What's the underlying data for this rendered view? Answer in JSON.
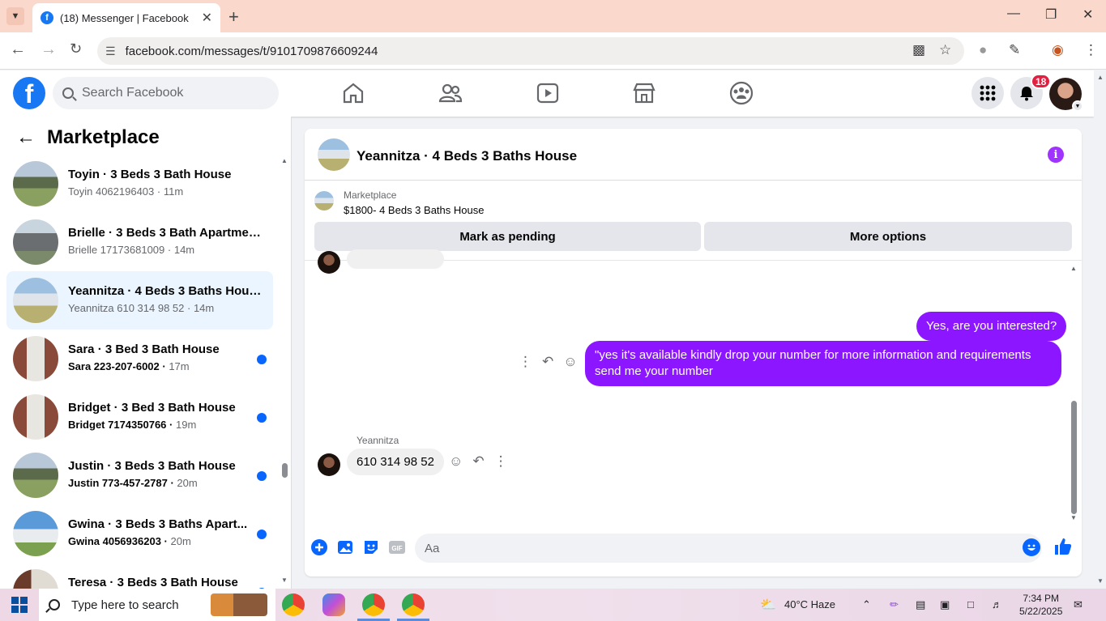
{
  "browser": {
    "tab_title": "(18) Messenger | Facebook",
    "url": "facebook.com/messages/t/9101709876609244"
  },
  "header": {
    "search_placeholder": "Search Facebook",
    "notification_count": "18",
    "brand_color": "#1877f2"
  },
  "sidebar": {
    "title": "Marketplace",
    "conversations": [
      {
        "name": "Toyin · 3 Beds 3 Bath House",
        "sub": "Toyin 4062196403",
        "time": "11m",
        "unread": false,
        "active": false
      },
      {
        "name": "Brielle · 3 Beds 3 Bath Apartmen...",
        "sub": "Brielle 17173681009",
        "time": "14m",
        "unread": false,
        "active": false
      },
      {
        "name": "Yeannitza · 4 Beds 3 Baths House",
        "sub": "Yeannitza 610 314 98 52",
        "time": "14m",
        "unread": false,
        "active": true
      },
      {
        "name": "Sara · 3 Bed 3 Bath House",
        "sub": "Sara 223-207-6002",
        "time": "17m",
        "unread": true,
        "active": false
      },
      {
        "name": "Bridget · 3 Bed 3 Bath House",
        "sub": "Bridget 7174350766",
        "time": "19m",
        "unread": true,
        "active": false
      },
      {
        "name": "Justin · 3 Beds 3 Bath House",
        "sub": "Justin 773-457-2787",
        "time": "20m",
        "unread": true,
        "active": false
      },
      {
        "name": "Gwina · 3 Beds 3 Baths Apart...",
        "sub": "Gwina 4056936203",
        "time": "20m",
        "unread": true,
        "active": false
      },
      {
        "name": "Teresa · 3 Beds 3 Bath House",
        "sub": "",
        "time": "",
        "unread": true,
        "active": false
      }
    ]
  },
  "chat": {
    "title": "Yeannitza · 4 Beds 3 Baths House",
    "marketplace_label": "Marketplace",
    "listing": "$1800- 4 Beds 3 Baths House",
    "mark_pending": "Mark as pending",
    "more_options": "More options",
    "messages": {
      "out1": "Yes, are you interested?",
      "out2": "\"yes it's available kindly drop your number for more information and requirements send me your number",
      "in_sender": "Yeannitza",
      "in1": "610 314 98 52"
    },
    "composer_placeholder": "Aa",
    "bubble_color": "#8b16ff"
  },
  "taskbar": {
    "search_text": "Type here to search",
    "weather": "40°C  Haze",
    "time": "7:34 PM",
    "date": "5/22/2025"
  }
}
